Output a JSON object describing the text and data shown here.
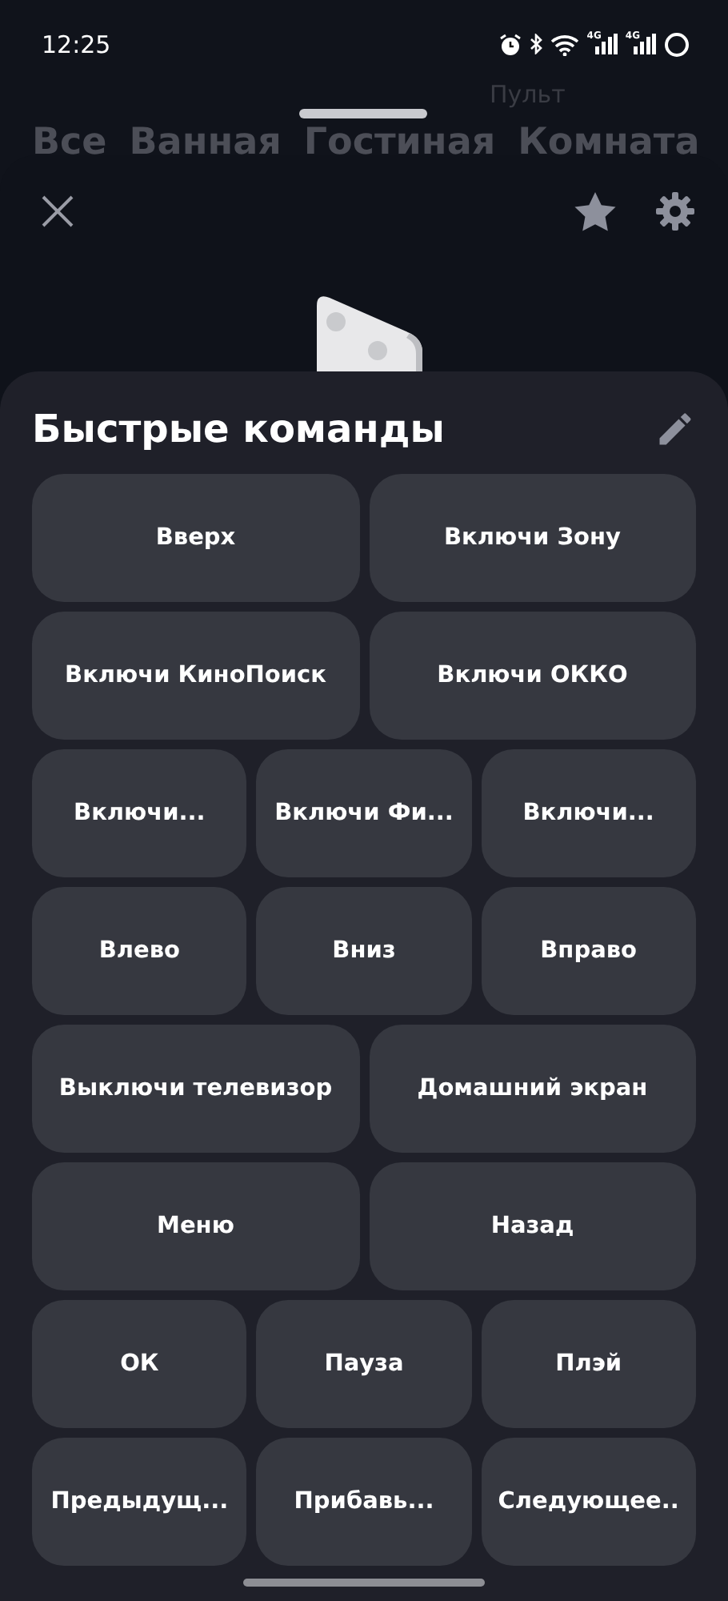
{
  "status_bar": {
    "time": "12:25",
    "network_labels": [
      "4G",
      "4G"
    ]
  },
  "background": {
    "label": "Пульт",
    "tabs": [
      "Все",
      "Ванная",
      "Гостиная",
      "Комната"
    ]
  },
  "quick_commands": {
    "title": "Быстрые команды",
    "rows": [
      [
        "Вверх",
        "Включи Зону"
      ],
      [
        "Включи КиноПоиск",
        "Включи ОККО"
      ],
      [
        "Включи...",
        "Включи Фи...",
        "Включи..."
      ],
      [
        "Влево",
        "Вниз",
        "Вправо"
      ],
      [
        "Выключи телевизор",
        "Домашний экран"
      ],
      [
        "Меню",
        "Назад"
      ],
      [
        "ОК",
        "Пауза",
        "Плэй"
      ],
      [
        "Предыдущ...",
        "Прибавь...",
        "Следующее.."
      ]
    ]
  }
}
